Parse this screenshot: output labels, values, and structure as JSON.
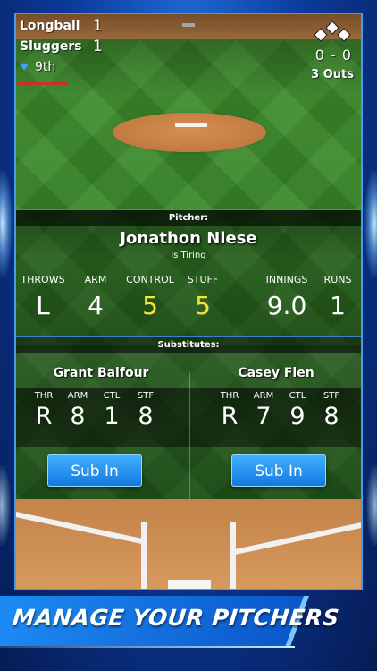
{
  "scoreboard": {
    "teams": [
      {
        "name": "Longball",
        "score": "1"
      },
      {
        "name": "Sluggers",
        "score": "1"
      }
    ],
    "inning": "9th",
    "count": "0 - 0",
    "outs": "3 Outs"
  },
  "pitcher": {
    "section_label": "Pitcher:",
    "name": "Jonathon Niese",
    "status": "is Tiring",
    "stats": [
      {
        "label": "THROWS",
        "value": "L"
      },
      {
        "label": "ARM",
        "value": "4"
      },
      {
        "label": "CONTROL",
        "value": "5"
      },
      {
        "label": "STUFF",
        "value": "5"
      },
      {
        "label": "INNINGS",
        "value": "9.0"
      },
      {
        "label": "RUNS",
        "value": "1"
      }
    ]
  },
  "substitutes": {
    "section_label": "Substitutes:",
    "players": [
      {
        "name": "Grant Balfour",
        "stats": [
          {
            "label": "THR",
            "value": "R"
          },
          {
            "label": "ARM",
            "value": "8"
          },
          {
            "label": "CTL",
            "value": "1"
          },
          {
            "label": "STF",
            "value": "8"
          }
        ],
        "button": "Sub In"
      },
      {
        "name": "Casey Fien",
        "stats": [
          {
            "label": "THR",
            "value": "R"
          },
          {
            "label": "ARM",
            "value": "7"
          },
          {
            "label": "CTL",
            "value": "9"
          },
          {
            "label": "STF",
            "value": "8"
          }
        ],
        "button": "Sub In"
      }
    ]
  },
  "banner": {
    "text": "MANAGE YOUR PITCHERS"
  },
  "colors": {
    "accent_blue": "#1d8bf3",
    "highlight_yellow": "#f2e23a",
    "inning_arrow": "#3fa0ff"
  }
}
